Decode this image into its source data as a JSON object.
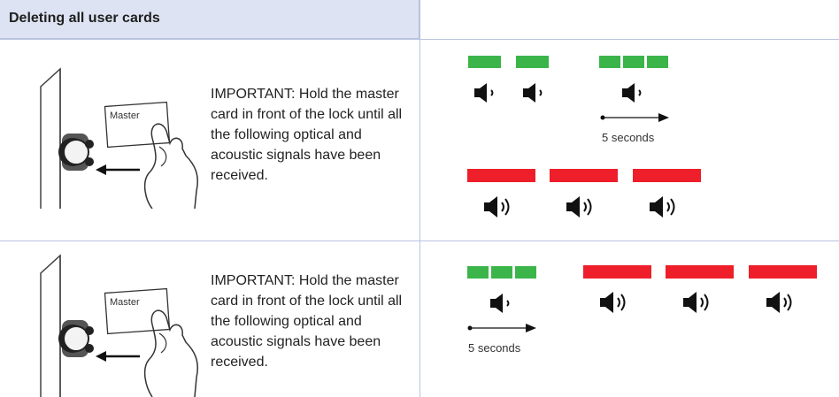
{
  "header": {
    "title": "Deleting all user cards"
  },
  "rows": [
    {
      "image": {
        "card_text": "Master"
      },
      "note": "IMPORTANT: Hold the master card in front of the lock until all the following optical and acoustic signals have been received.",
      "arrow_label": "5 seconds"
    },
    {
      "image": {
        "card_text": "Master"
      },
      "note": "IMPORTANT: Hold the master card in front of the lock until all the following optical and acoustic signals have been received.",
      "arrow_label": "5 seconds"
    }
  ],
  "colors": {
    "green": "#3bb54a",
    "red": "#ee1f2a",
    "header_bg": "#dde3f2",
    "grid": "#b9c4df"
  },
  "icons": [
    "speaker-short-beep-icon",
    "speaker-long-beep-icon",
    "arrow-right-icon",
    "lock-illustration"
  ]
}
